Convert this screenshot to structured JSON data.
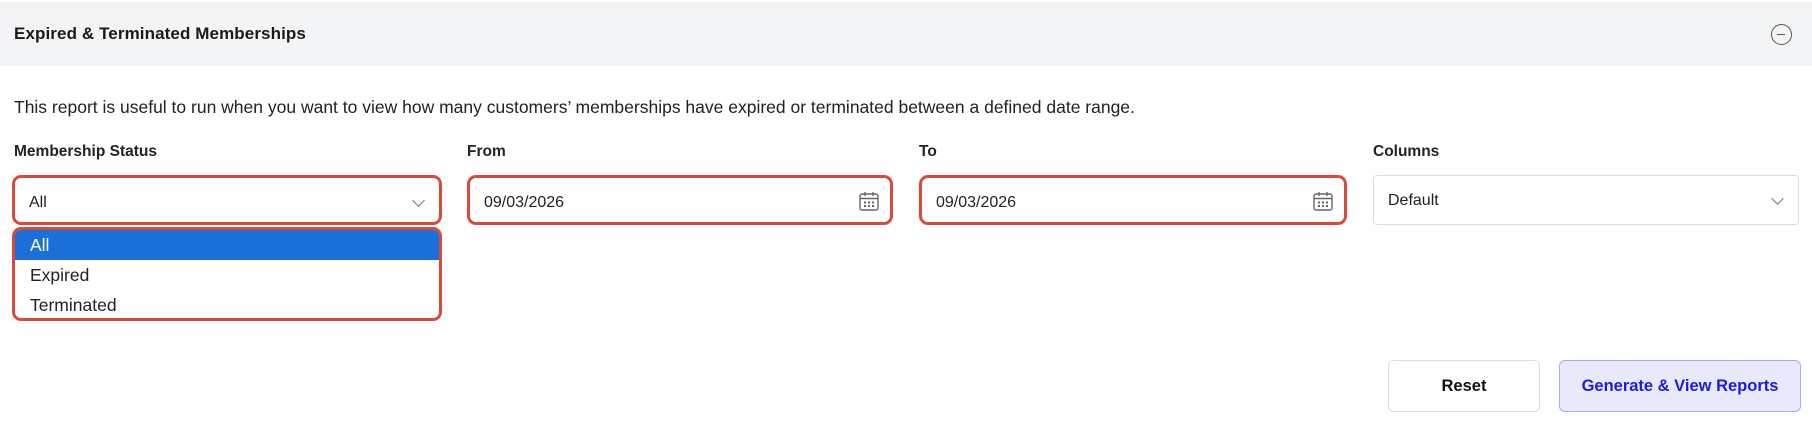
{
  "panel": {
    "title": "Expired & Terminated Memberships",
    "collapse_icon": "minus-circle-icon"
  },
  "description": "This report is useful to run when you want to view how many customers’ memberships have expired or terminated between a defined date range.",
  "fields": {
    "membership_status": {
      "label": "Membership Status",
      "value": "All",
      "options": [
        "All",
        "Expired",
        "Terminated"
      ],
      "selected_option": "All"
    },
    "from": {
      "label": "From",
      "value": "09/03/2026",
      "icon": "calendar-icon"
    },
    "to": {
      "label": "To",
      "value": "09/03/2026",
      "icon": "calendar-icon"
    },
    "columns": {
      "label": "Columns",
      "value": "Default"
    }
  },
  "buttons": {
    "reset": "Reset",
    "generate": "Generate & View Reports"
  },
  "colors": {
    "highlight": "#d94a3a",
    "selected_option": "#1a6fd8",
    "generate_text": "#1a1ae0",
    "generate_bg": "#e9e9fc"
  }
}
